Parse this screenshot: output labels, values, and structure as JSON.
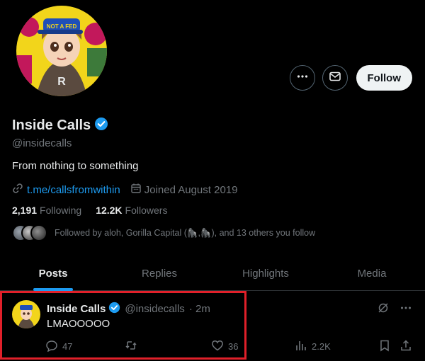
{
  "profile": {
    "name": "Inside Calls",
    "handle": "@insidecalls",
    "bio": "From nothing to something",
    "link": "t.me/callsfromwithin",
    "joined": "Joined August 2019",
    "following_count": "2,191",
    "following_label": "Following",
    "followers_count": "12.2K",
    "followers_label": "Followers",
    "followed_by": "Followed by aloh, Gorilla Capital (🦍,🦍), and 13 others you follow",
    "avatar_badge_text": "NOT A FED"
  },
  "actions": {
    "more_icon": "more-icon",
    "message_icon": "envelope-icon",
    "follow_label": "Follow"
  },
  "tabs": [
    {
      "label": "Posts",
      "active": true
    },
    {
      "label": "Replies",
      "active": false
    },
    {
      "label": "Highlights",
      "active": false
    },
    {
      "label": "Media",
      "active": false
    }
  ],
  "post": {
    "name": "Inside Calls",
    "handle": "@insidecalls",
    "time": "· 2m",
    "text": "LMAOOOOO",
    "replies": "47",
    "reposts": "",
    "likes": "36",
    "views": "2.2K"
  },
  "colors": {
    "accent": "#1d9bf0",
    "highlight_border": "#e0202a",
    "background": "#000000",
    "muted": "#71767b"
  }
}
